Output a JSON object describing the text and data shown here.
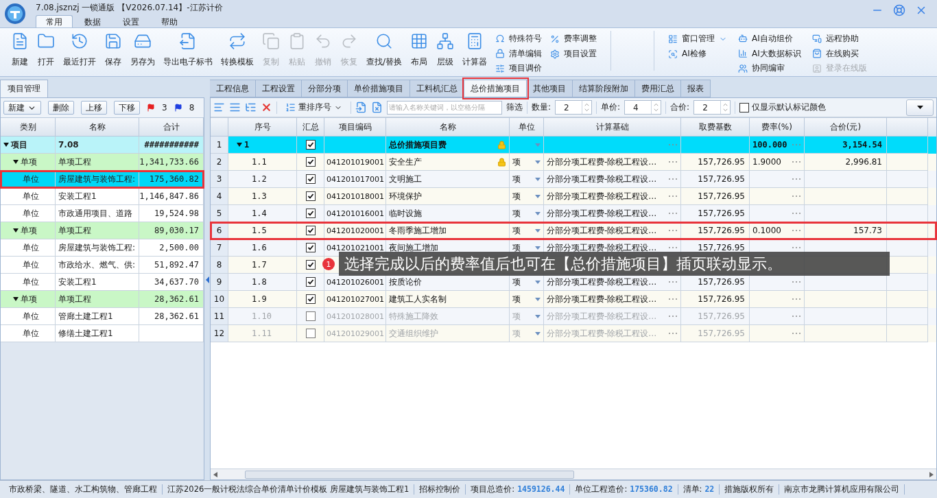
{
  "window": {
    "title": "7.08.jsznzj 一锁通版 【V2026.07.14】-江苏计价"
  },
  "menu_tabs": [
    {
      "label": "常用",
      "selected": true
    },
    {
      "label": "数据",
      "selected": false
    },
    {
      "label": "设置",
      "selected": false
    },
    {
      "label": "帮助",
      "selected": false
    }
  ],
  "ribbon": {
    "large_buttons": [
      {
        "label": "新建",
        "disabled": false
      },
      {
        "label": "打开",
        "disabled": false
      },
      {
        "label": "最近打开",
        "disabled": false
      },
      {
        "label": "保存",
        "disabled": false
      },
      {
        "label": "另存为",
        "disabled": false
      },
      {
        "label": "导出电子标书",
        "disabled": false
      },
      {
        "label": "转换模板",
        "disabled": false
      },
      {
        "label": "复制",
        "disabled": true
      },
      {
        "label": "粘贴",
        "disabled": true
      },
      {
        "label": "撤销",
        "disabled": true
      },
      {
        "label": "恢复",
        "disabled": true
      },
      {
        "label": "查找/替换",
        "disabled": false
      },
      {
        "label": "布局",
        "disabled": false
      },
      {
        "label": "层级",
        "disabled": false
      },
      {
        "label": "计算器",
        "disabled": false
      }
    ],
    "small_columns": [
      [
        {
          "label": "特殊符号",
          "disabled": false
        },
        {
          "label": "清单编辑",
          "disabled": false
        },
        {
          "label": "项目调价",
          "disabled": false
        }
      ],
      [
        {
          "label": "费率调整",
          "disabled": false
        },
        {
          "label": "项目设置",
          "disabled": false
        }
      ]
    ],
    "right_columns": [
      [
        {
          "label": "窗口管理",
          "disabled": false,
          "dropdown": true
        },
        {
          "label": "AI检修",
          "disabled": false,
          "dropdown": false
        }
      ],
      [
        {
          "label": "AI自动组价",
          "disabled": false,
          "dropdown": false
        },
        {
          "label": "AI大数据标识",
          "disabled": false,
          "dropdown": false
        },
        {
          "label": "协同编审",
          "disabled": false,
          "dropdown": false
        }
      ],
      [
        {
          "label": "远程协助",
          "disabled": false,
          "dropdown": false
        },
        {
          "label": "在线购买",
          "disabled": false,
          "dropdown": false
        },
        {
          "label": "登录在线版",
          "disabled": true,
          "dropdown": false
        }
      ]
    ]
  },
  "left_panel": {
    "tab": "项目管理",
    "new_button": "新建",
    "buttons": [
      "删除",
      "上移",
      "下移"
    ],
    "red_flag_count": "3",
    "blue_flag_count": "8",
    "columns": [
      "类别",
      "名称",
      "合计"
    ],
    "tree": [
      {
        "category": "项目",
        "name": "7.08",
        "total": "###########",
        "expanded": true,
        "selected": false,
        "highlighted": false,
        "children": [
          {
            "category": "单项",
            "name": "单项工程",
            "total": "1,341,733.66",
            "expanded": true,
            "selected": false,
            "highlighted": false,
            "children": [
              {
                "category": "单位",
                "name": "房屋建筑与装饰工程:",
                "total": "175,360.82",
                "selected": true,
                "highlighted": true
              },
              {
                "category": "单位",
                "name": "安装工程1",
                "total": "1,146,847.86",
                "selected": false,
                "highlighted": false
              },
              {
                "category": "单位",
                "name": "市政通用项目、道路",
                "total": "19,524.98",
                "selected": false,
                "highlighted": false
              }
            ]
          },
          {
            "category": "单项",
            "name": "单项工程",
            "total": "89,030.17",
            "expanded": true,
            "selected": false,
            "highlighted": false,
            "children": [
              {
                "category": "单位",
                "name": "房屋建筑与装饰工程:",
                "total": "2,500.00",
                "selected": false,
                "highlighted": false
              },
              {
                "category": "单位",
                "name": "市政给水、燃气、供:",
                "total": "51,892.47",
                "selected": false,
                "highlighted": false
              },
              {
                "category": "单位",
                "name": "安装工程1",
                "total": "34,637.70",
                "selected": false,
                "highlighted": false
              }
            ]
          },
          {
            "category": "单项",
            "name": "单项工程",
            "total": "28,362.61",
            "expanded": true,
            "selected": false,
            "highlighted": false,
            "children": [
              {
                "category": "单位",
                "name": "管廊土建工程1",
                "total": "28,362.61",
                "selected": false,
                "highlighted": false
              },
              {
                "category": "单位",
                "name": "修缮土建工程1",
                "selected": false,
                "highlighted": false
              }
            ]
          }
        ]
      }
    ]
  },
  "content_tabs": [
    {
      "label": "工程信息",
      "selected": false,
      "highlighted": false
    },
    {
      "label": "工程设置",
      "selected": false,
      "highlighted": false
    },
    {
      "label": "分部分项",
      "selected": false,
      "highlighted": false
    },
    {
      "label": "单价措施项目",
      "selected": false,
      "highlighted": false
    },
    {
      "label": "工料机汇总",
      "selected": false,
      "highlighted": false
    },
    {
      "label": "总价措施项目",
      "selected": true,
      "highlighted": true
    },
    {
      "label": "其他项目",
      "selected": false,
      "highlighted": false
    },
    {
      "label": "结算阶段附加",
      "selected": false,
      "highlighted": false
    },
    {
      "label": "费用汇总",
      "selected": false,
      "highlighted": false
    },
    {
      "label": "报表",
      "selected": false,
      "highlighted": false
    }
  ],
  "toolbar": {
    "reorder_button": "重排序号",
    "search": {
      "placeholder": "请输入名称关键词，以空格分隔"
    },
    "filter_label": "筛选",
    "spinners": [
      {
        "label": "数量:",
        "value": "2"
      },
      {
        "label": "单价:",
        "value": "4"
      },
      {
        "label": "合价:",
        "value": "2"
      }
    ],
    "checkbox": {
      "label": "仅显示默认标记颜色",
      "checked": false
    }
  },
  "table": {
    "columns": [
      "序号",
      "汇总",
      "项目编码",
      "名称",
      "单位",
      "计算基础",
      "取费基数",
      "费率(%)",
      "合价(元)"
    ],
    "rows": [
      {
        "row_number": "1",
        "seq": "1",
        "expanded": true,
        "checked": true,
        "name": "总价措施项目费",
        "locked": true,
        "rate": "100.000",
        "total": "3,154.54",
        "disabled": false,
        "highlighted": false,
        "children": [
          {
            "row_number": "2",
            "seq": "1.1",
            "checked": true,
            "code": "041201019001",
            "name": "安全生产",
            "locked": true,
            "unit": "项",
            "base": "分部分项工程费-除税工程设…",
            "amount": "157,726.95",
            "rate": "1.9000",
            "total": "2,996.81",
            "disabled": false,
            "highlighted": false
          },
          {
            "row_number": "3",
            "seq": "1.2",
            "checked": true,
            "code": "041201017001",
            "name": "文明施工",
            "locked": false,
            "unit": "项",
            "base": "分部分项工程费-除税工程设…",
            "amount": "157,726.95",
            "disabled": false,
            "highlighted": false
          },
          {
            "row_number": "4",
            "seq": "1.3",
            "checked": true,
            "code": "041201018001",
            "name": "环境保护",
            "locked": false,
            "unit": "项",
            "base": "分部分项工程费-除税工程设…",
            "amount": "157,726.95",
            "disabled": false,
            "highlighted": false
          },
          {
            "row_number": "5",
            "seq": "1.4",
            "checked": true,
            "code": "041201016001",
            "name": "临时设施",
            "locked": false,
            "unit": "项",
            "base": "分部分项工程费-除税工程设…",
            "amount": "157,726.95",
            "disabled": false,
            "highlighted": false
          },
          {
            "row_number": "6",
            "seq": "1.5",
            "checked": true,
            "code": "041201020001",
            "name": "冬雨季施工增加",
            "locked": false,
            "unit": "项",
            "base": "分部分项工程费-除税工程设…",
            "amount": "157,726.95",
            "rate": "0.1000",
            "total": "157.73",
            "disabled": false,
            "highlighted": true
          },
          {
            "row_number": "7",
            "seq": "1.6",
            "checked": true,
            "code": "041201021001",
            "name": "夜间施工增加",
            "locked": false,
            "unit": "项",
            "base": "分部分项工程费-除税工程设…",
            "amount": "157,726.95",
            "disabled": false,
            "highlighted": false
          },
          {
            "row_number": "8",
            "seq": "1.7",
            "checked": true,
            "locked": false,
            "disabled": false,
            "highlighted": false
          },
          {
            "row_number": "9",
            "seq": "1.8",
            "checked": true,
            "code": "041201026001",
            "name": "按质论价",
            "locked": false,
            "unit": "项",
            "base": "分部分项工程费-除税工程设…",
            "amount": "157,726.95",
            "disabled": false,
            "highlighted": false
          },
          {
            "row_number": "10",
            "seq": "1.9",
            "checked": true,
            "code": "041201027001",
            "name": "建筑工人实名制",
            "locked": false,
            "unit": "项",
            "base": "分部分项工程费-除税工程设…",
            "amount": "157,726.95",
            "disabled": false,
            "highlighted": false
          },
          {
            "row_number": "11",
            "seq": "1.10",
            "checked": false,
            "code": "041201028001",
            "name": "特殊施工降效",
            "locked": false,
            "unit": "项",
            "base": "分部分项工程费-除税工程设…",
            "amount": "157,726.95",
            "disabled": true,
            "highlighted": false
          },
          {
            "row_number": "12",
            "seq": "1.11",
            "checked": false,
            "code": "041201029001",
            "name": "交通组织维护",
            "locked": false,
            "unit": "项",
            "base": "分部分项工程费-除税工程设…",
            "amount": "157,726.95",
            "disabled": true,
            "highlighted": false
          }
        ]
      }
    ]
  },
  "tooltip": {
    "badge": "1",
    "text": "选择完成以后的费率值后也可在【总价措施项目】插页联动显示。"
  },
  "status_bar": [
    {
      "label": "市政桥梁、隧道、水工构筑物、管廊工程"
    },
    {
      "label": "江苏2026一般计税法综合单价清单计价模板 房屋建筑与装饰工程1"
    },
    {
      "label": "招标控制价"
    },
    {
      "label": "项目总造价:",
      "value": "1459126.44"
    },
    {
      "label": "单位工程造价:",
      "value": "175360.82"
    },
    {
      "label": "清单:",
      "value": "22"
    },
    {
      "label": "措施版权所有"
    },
    {
      "label": "南京市龙腾计算机应用有限公司"
    }
  ]
}
